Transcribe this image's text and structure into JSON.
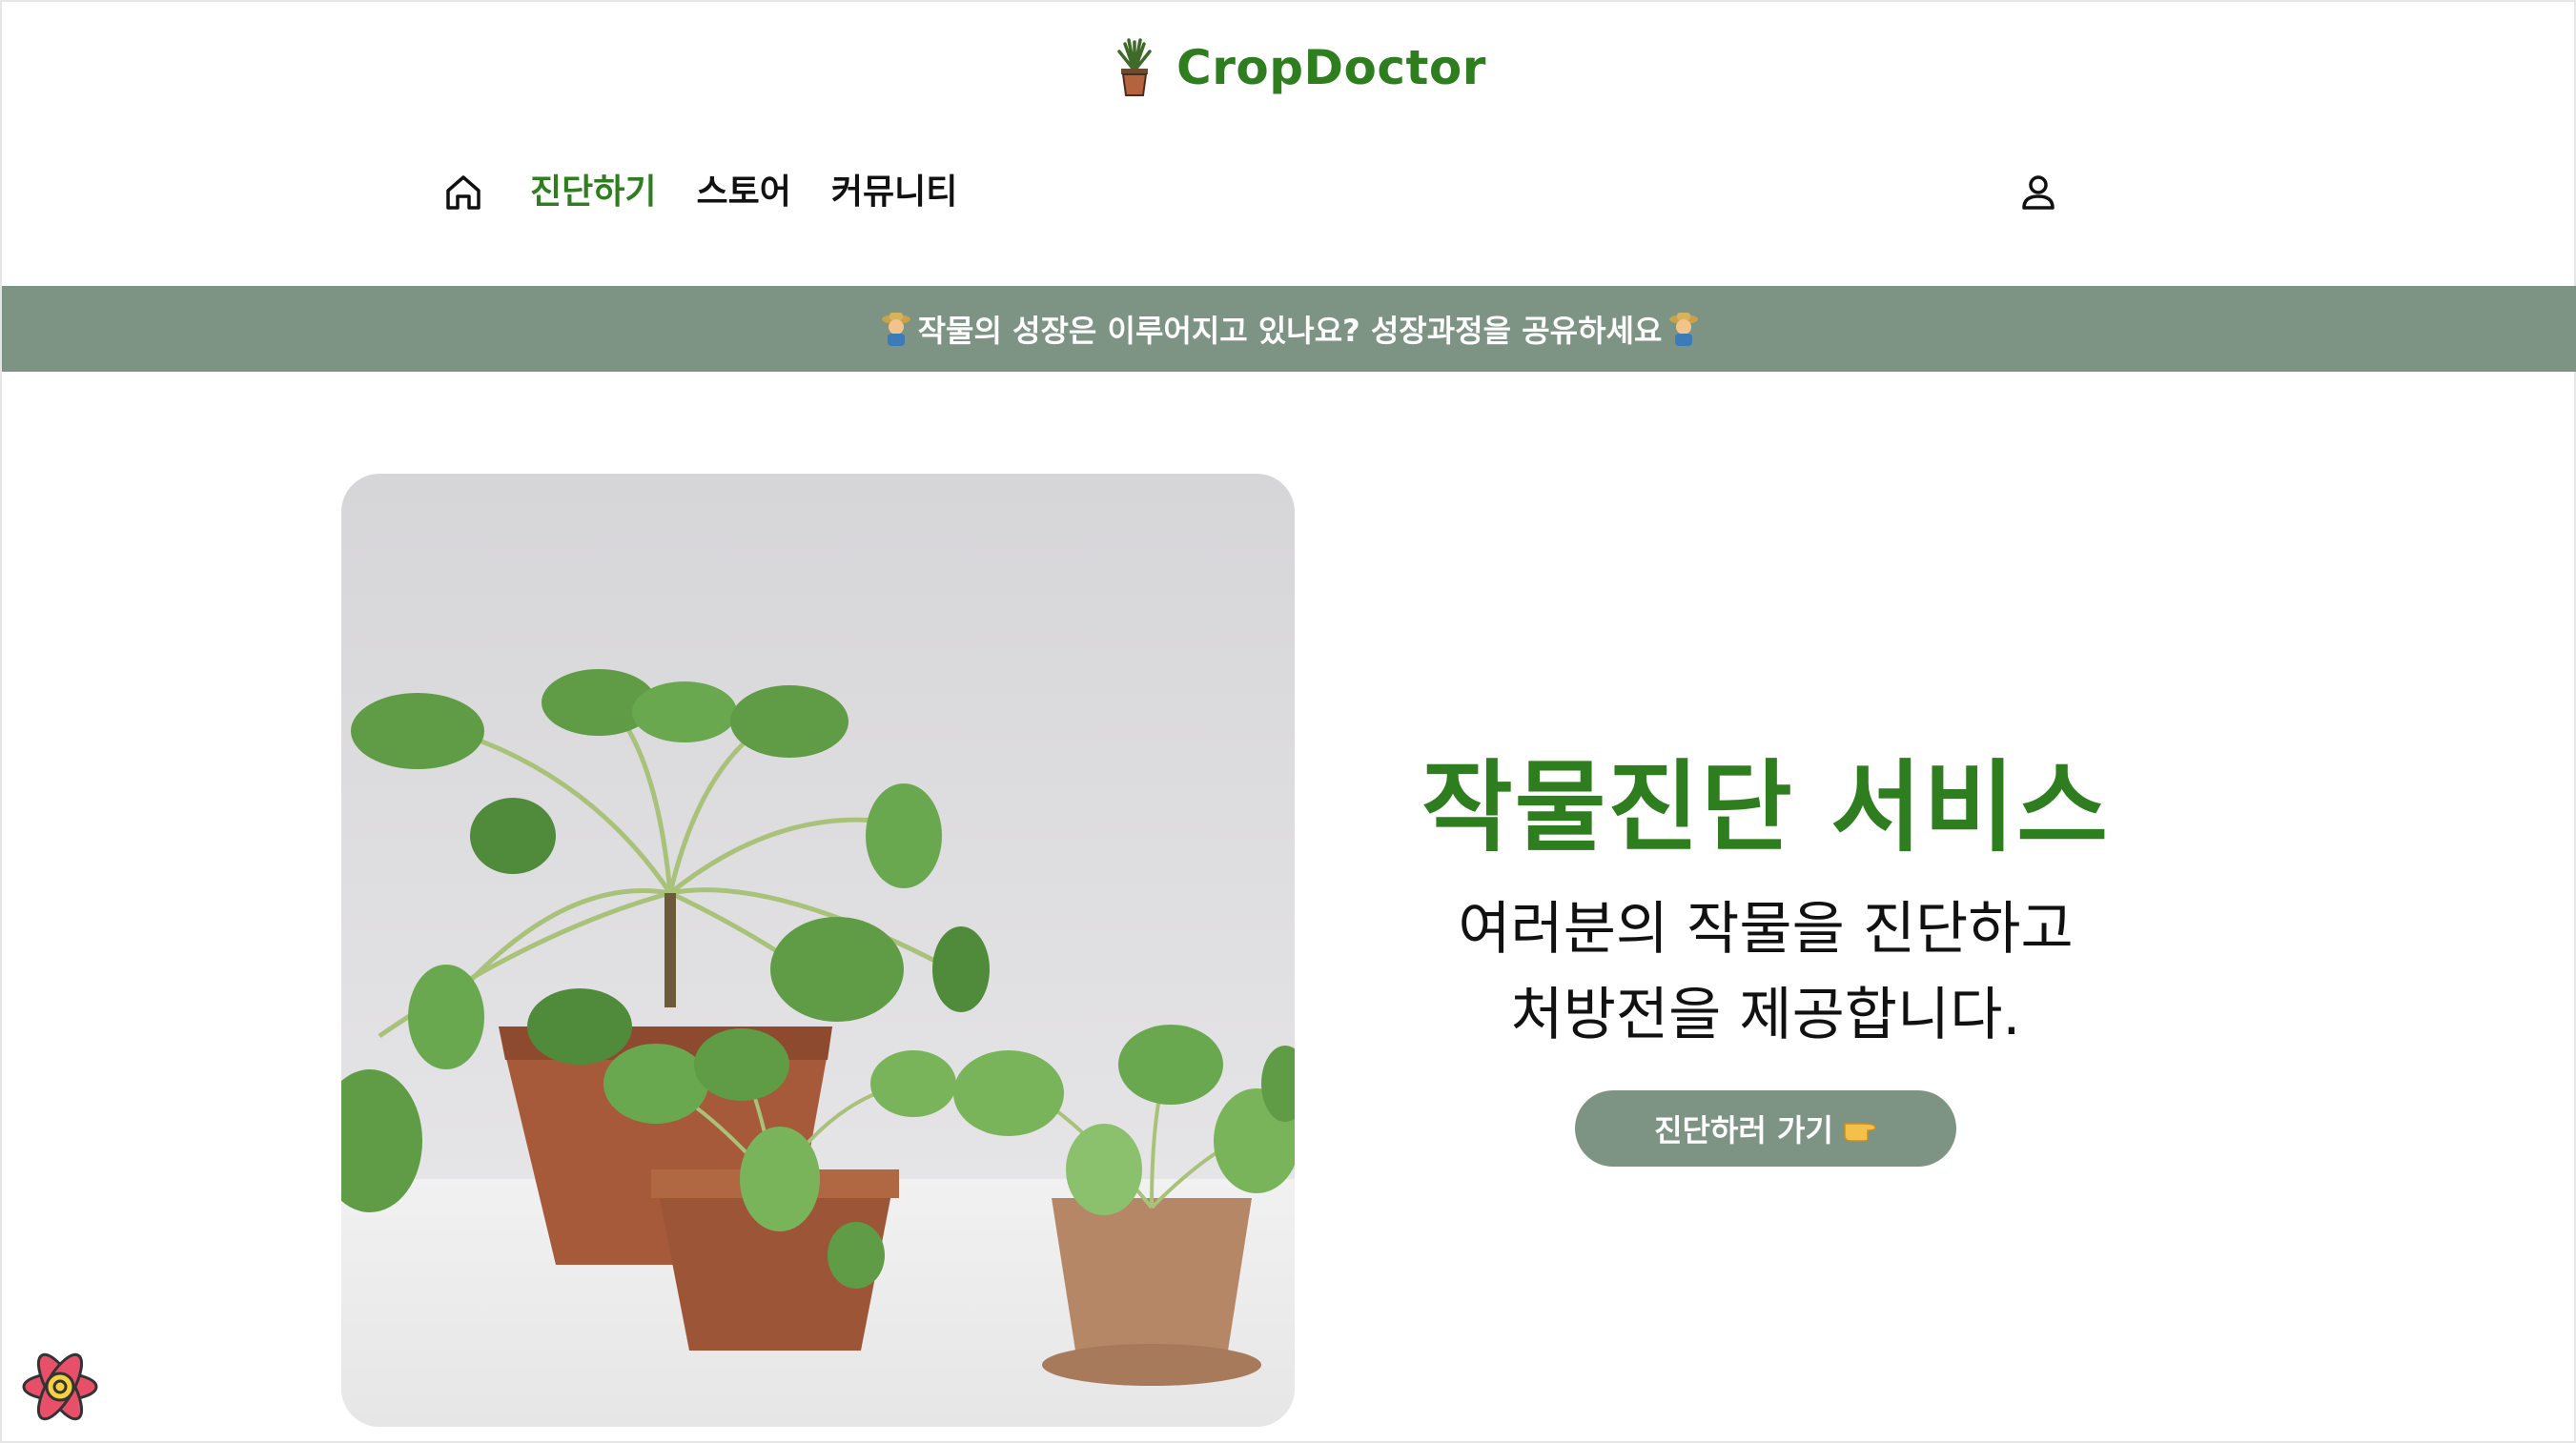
{
  "brand": {
    "name": "CropDoctor",
    "logo_icon": "potted-plant-icon",
    "color": "#2e7d1e"
  },
  "nav": {
    "home_icon": "home-icon",
    "items": [
      {
        "label": "진단하기",
        "active": true
      },
      {
        "label": "스토어",
        "active": false
      },
      {
        "label": "커뮤니티",
        "active": false
      }
    ],
    "user_icon": "user-icon"
  },
  "banner": {
    "text": "작물의 성장은 이루어지고 있나요? 성장과정을 공유하세요",
    "icon": "farmer-emoji",
    "color": "#7d9485"
  },
  "hero": {
    "title": "작물진단 서비스",
    "subtitle_line1": "여러분의 작물을 진단하고",
    "subtitle_line2": "처방전을 제공합니다.",
    "cta_label": "진단하러 가기",
    "cta_icon": "pointing-hand-emoji"
  },
  "devtools": {
    "icon": "react-devtools-icon"
  }
}
